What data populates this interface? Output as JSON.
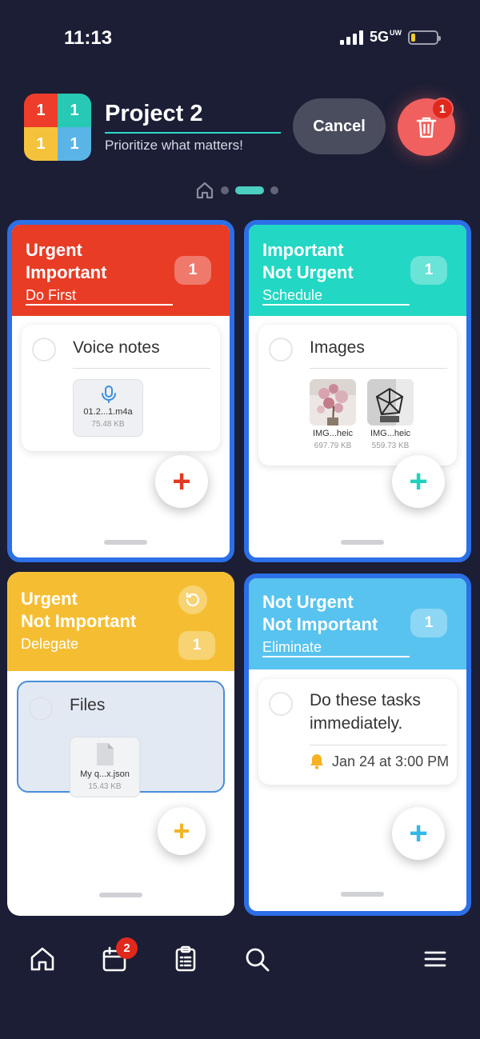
{
  "status": {
    "time": "11:13",
    "network": "5G",
    "network_suffix": "UW"
  },
  "logo": {
    "cells": [
      "1",
      "1",
      "1",
      "1"
    ],
    "colors": [
      "#ef3d2b",
      "#27c9b4",
      "#f5c33b",
      "#5ab4e6"
    ]
  },
  "header": {
    "title": "Project 2",
    "subtitle": "Prioritize what matters!",
    "cancel_label": "Cancel",
    "trash_badge": "1"
  },
  "quadrants": [
    {
      "title_line1": "Urgent",
      "title_line2": "Important",
      "subtitle": "Do First",
      "count": "1",
      "color": "#e83c25",
      "card": {
        "title": "Voice notes",
        "attachment_name": "01.2...1.m4a",
        "attachment_size": "75.48 KB",
        "icon": "microphone-icon"
      },
      "add_label": "+"
    },
    {
      "title_line1": "Important",
      "title_line2": "Not Urgent",
      "subtitle": "Schedule",
      "count": "1",
      "color": "#22d7c3",
      "card": {
        "title": "Images",
        "images": [
          {
            "name": "IMG...heic",
            "size": "697.79 KB"
          },
          {
            "name": "IMG...heic",
            "size": "559.73 KB"
          }
        ]
      },
      "add_label": "+"
    },
    {
      "title_line1": "Urgent",
      "title_line2": "Not Important",
      "subtitle": "Delegate",
      "count": "1",
      "color": "#f5be32",
      "card": {
        "title": "Files",
        "attachment_name": "My q...x.json",
        "attachment_size": "15.43 KB",
        "icon": "file-icon"
      },
      "add_label": "+"
    },
    {
      "title_line1": "Not Urgent",
      "title_line2": "Not Important",
      "subtitle": "Eliminate",
      "count": "1",
      "color": "#58c3ef",
      "card": {
        "title_line1": "Do these tasks",
        "title_line2": "immediately.",
        "reminder": "Jan 24 at 3:00 PM",
        "icon": "bell-icon"
      },
      "add_label": "+"
    }
  ],
  "bottom_nav": {
    "calendar_badge": "2",
    "items": [
      "home-icon",
      "calendar-icon",
      "clipboard-icon",
      "search-icon",
      "menu-icon"
    ]
  }
}
